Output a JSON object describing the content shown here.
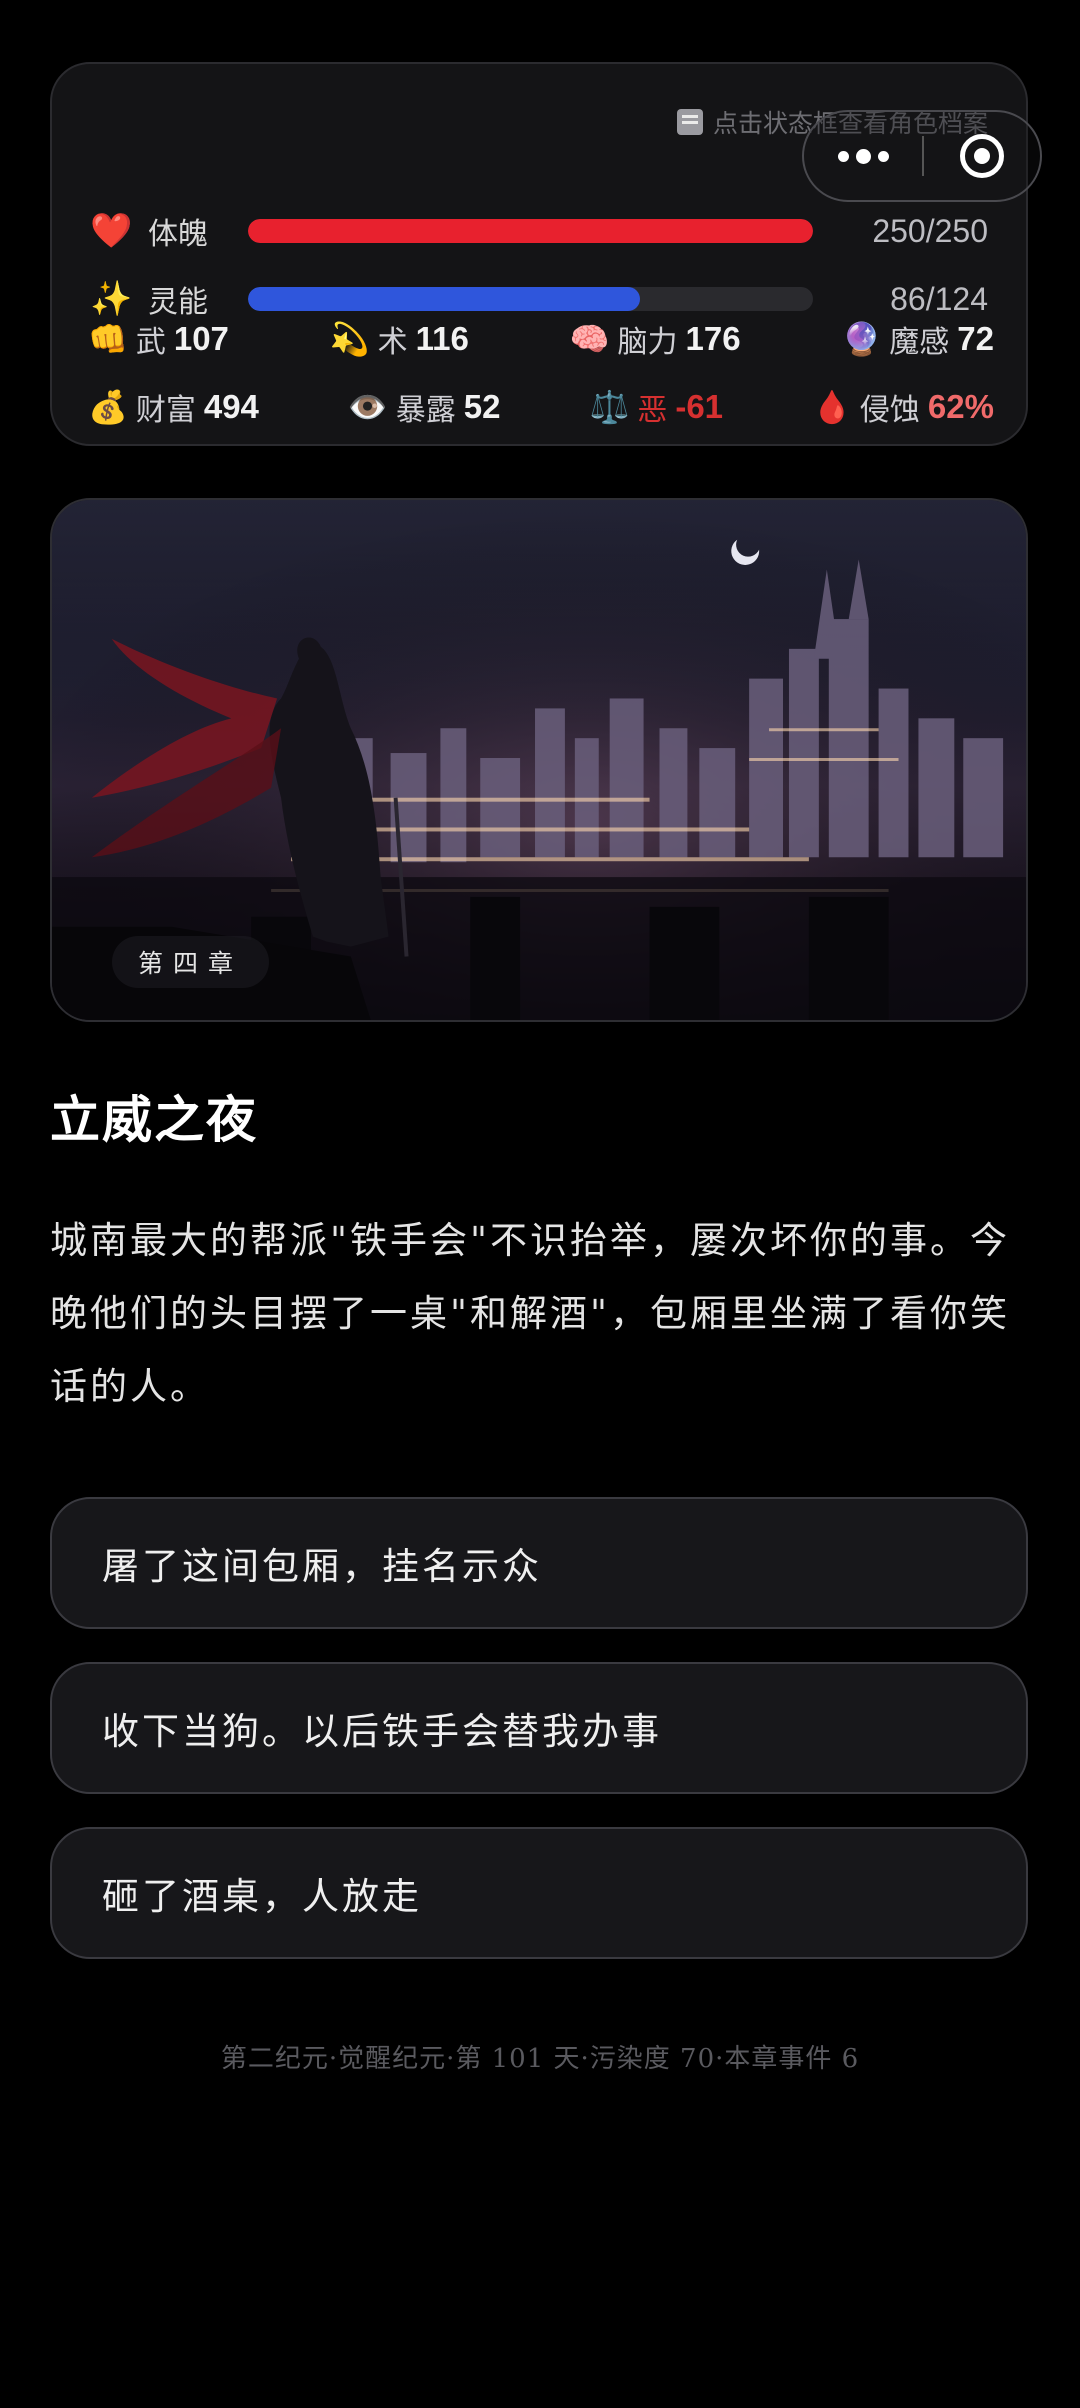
{
  "hint": {
    "text": "点击状态框查看角色档案",
    "icon": "profile-card-icon"
  },
  "bars": [
    {
      "icon": "❤️",
      "icon_name": "heart-icon",
      "label": "体魄",
      "value_text": "250/250",
      "fill": 1.0,
      "color": "#e8212e"
    },
    {
      "icon": "✨",
      "icon_name": "sparkles-icon",
      "label": "灵能",
      "value_text": "86/124",
      "fill": 0.694,
      "color": "#2f56dc"
    }
  ],
  "stats_row1": [
    {
      "icon": "👊",
      "icon_name": "fist-icon",
      "label": "武",
      "value": "107",
      "color": "#f2f2f2"
    },
    {
      "icon": "💫",
      "icon_name": "dizzy-star-icon",
      "label": "术",
      "value": "116",
      "color": "#f2f2f2"
    },
    {
      "icon": "🧠",
      "icon_name": "brain-icon",
      "label": "脑力",
      "value": "176",
      "color": "#f2f2f2"
    },
    {
      "icon": "🔮",
      "icon_name": "crystal-ball-icon",
      "label": "魔感",
      "value": "72",
      "color": "#f2f2f2"
    }
  ],
  "stats_row2": [
    {
      "icon": "💰",
      "icon_name": "money-bag-icon",
      "label": "财富",
      "value": "494",
      "color": "#f2f2f2",
      "label_color": "#cfcfd4"
    },
    {
      "icon": "👁️",
      "icon_name": "eye-icon",
      "label": "暴露",
      "value": "52",
      "color": "#f2f2f2",
      "label_color": "#cfcfd4"
    },
    {
      "icon": "⚖️",
      "icon_name": "scales-icon",
      "label": "恶",
      "value": "-61",
      "color": "#d63030",
      "label_color": "#d63030"
    },
    {
      "icon": "🩸",
      "icon_name": "blood-drop-icon",
      "label": "侵蚀",
      "value": "62%",
      "color": "#f06a6a",
      "label_color": "#cfcfd4"
    }
  ],
  "scene": {
    "chapter": "第四章",
    "description_icon": "cityscape-night-image"
  },
  "title": "立威之夜",
  "story": "城南最大的帮派\"铁手会\"不识抬举，屡次坏你的事。今晚他们的头目摆了一桌\"和解酒\"，包厢里坐满了看你笑话的人。",
  "choices": [
    "屠了这间包厢，挂名示众",
    "收下当狗。以后铁手会替我办事",
    "砸了酒桌，人放走"
  ],
  "footer": "第二纪元·觉醒纪元·第 101 天·污染度 70·本章事件 6"
}
